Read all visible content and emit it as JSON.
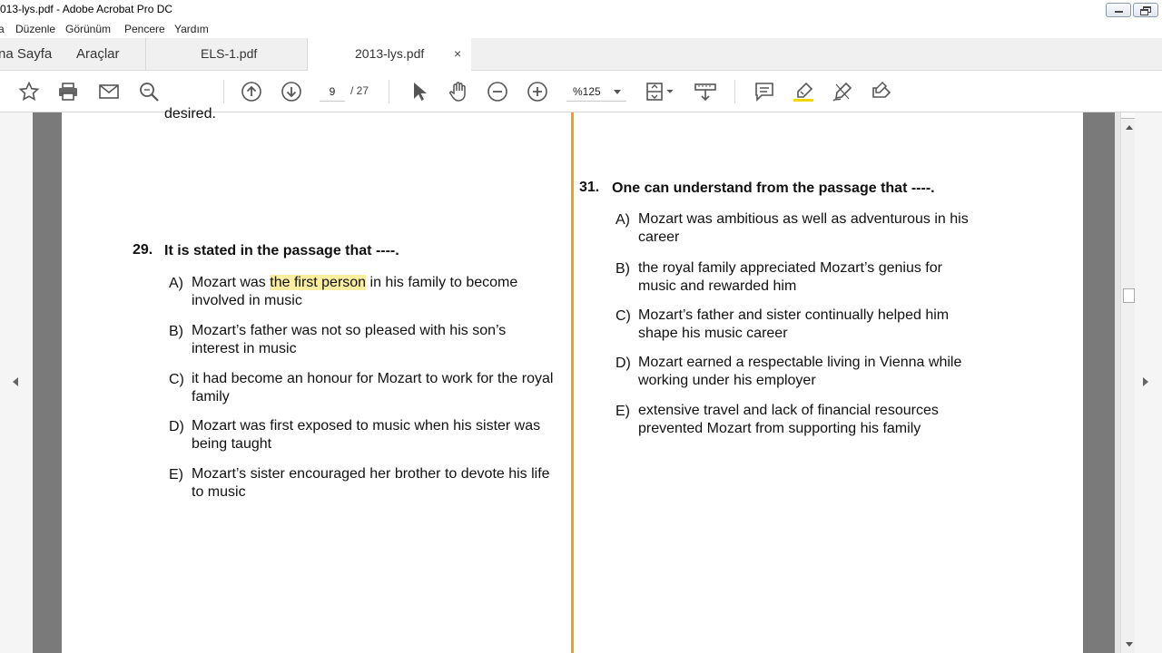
{
  "window": {
    "title": "013-lys.pdf - Adobe Acrobat Pro DC"
  },
  "menu": [
    "a",
    "Düzenle",
    "Görünüm",
    "Pencere",
    "Yardım"
  ],
  "tabs": {
    "home": "na Sayfa",
    "tools": "Araçlar",
    "doc1": "ELS-1.pdf",
    "doc2": "2013-lys.pdf",
    "close": "×"
  },
  "toolbar": {
    "page_current": "9",
    "page_total": "/ 27",
    "zoom": "%125",
    "icons": [
      "star-icon",
      "print-icon",
      "mail-icon",
      "search-icon",
      "arrow-up-icon",
      "arrow-down-icon",
      "pointer-icon",
      "hand-icon",
      "zoom-out-icon",
      "zoom-in-icon",
      "page-fit-icon",
      "scroll-mode-icon",
      "comment-icon",
      "highlight-icon",
      "sign-icon",
      "edit-icon"
    ]
  },
  "document": {
    "fragment_top": "desired.",
    "q29": {
      "number": "29.",
      "stem": "It is stated in the passage that ----.",
      "options": [
        {
          "letter": "A)",
          "line1_pre": "Mozart was ",
          "line1_hl": "the first person",
          "line1_post": " in his family to become",
          "line2": "involved in music"
        },
        {
          "letter": "B)",
          "text": "Mozart’s father was not so pleased with his son’s interest in music"
        },
        {
          "letter": "C)",
          "text": "it had become an honour for Mozart to work for the royal family"
        },
        {
          "letter": "D)",
          "text": "Mozart was first exposed to music when his sister was being taught"
        },
        {
          "letter": "E)",
          "text": "Mozart’s sister encouraged her brother to devote his life to music"
        }
      ]
    },
    "q31": {
      "number": "31.",
      "stem": "One can understand from the passage that ----.",
      "options": [
        {
          "letter": "A)",
          "text": "Mozart was ambitious as well as adventurous in his career"
        },
        {
          "letter": "B)",
          "text": "the royal family appreciated Mozart’s genius for music and rewarded him"
        },
        {
          "letter": "C)",
          "text": "Mozart’s father and sister continually helped him shape his music career"
        },
        {
          "letter": "D)",
          "text": "Mozart earned a respectable living in Vienna while working under his employer"
        },
        {
          "letter": "E)",
          "text": "extensive travel and lack of financial resources prevented Mozart from supporting his family"
        }
      ]
    }
  },
  "colors": {
    "divider": "#f0a020",
    "highlight": "#fbeea0",
    "gutter": "#7a7a7a"
  }
}
